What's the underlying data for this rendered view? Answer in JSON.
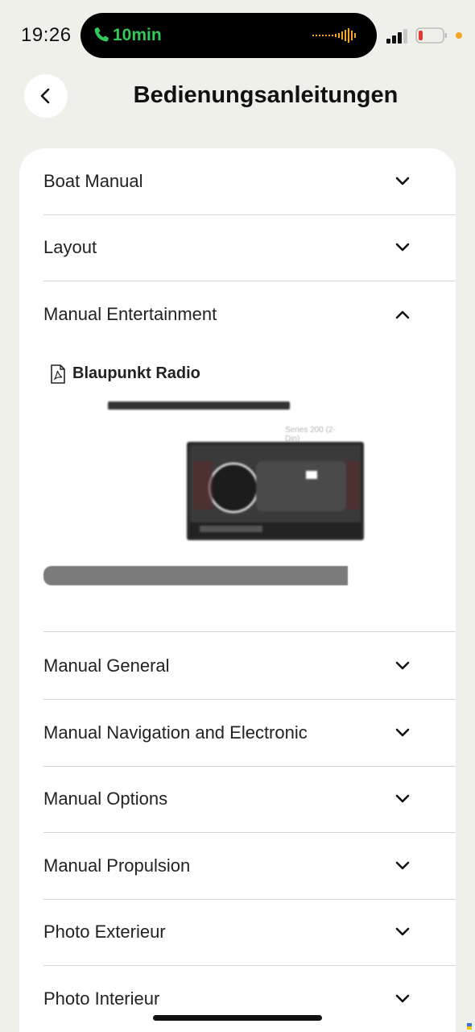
{
  "status_bar": {
    "time": "19:26",
    "call_duration": "10min",
    "call_icon": "phone-icon",
    "accent_green": "#34c759",
    "accent_orange": "#f4a623"
  },
  "header": {
    "title": "Bedienungsanleitungen",
    "back_icon": "chevron-left-icon"
  },
  "sections": [
    {
      "label": "Boat Manual",
      "expanded": false
    },
    {
      "label": "Layout",
      "expanded": false
    },
    {
      "label": "Manual Entertainment",
      "expanded": true
    },
    {
      "label": "Manual General",
      "expanded": false
    },
    {
      "label": "Manual Navigation and Electronic",
      "expanded": false
    },
    {
      "label": "Manual Options",
      "expanded": false
    },
    {
      "label": "Manual Propulsion",
      "expanded": false
    },
    {
      "label": "Photo Exterieur",
      "expanded": false
    },
    {
      "label": "Photo Interieur",
      "expanded": false
    }
  ],
  "expanded_content": {
    "file_icon": "pdf-file-icon",
    "file_name": "Blaupunkt Radio",
    "preview_series_label": "Series 200 (2-Din)",
    "preview_brand": "BLAUPUNKT"
  }
}
